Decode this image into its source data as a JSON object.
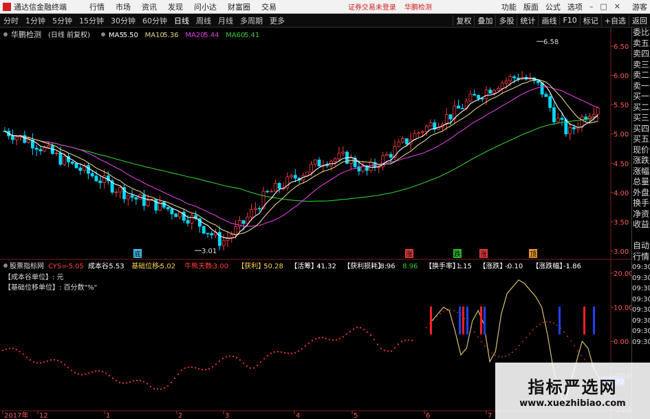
{
  "menubar": {
    "app_title": "通达信金融终端",
    "items": [
      "行情",
      "市场",
      "资讯",
      "发现",
      "问小达",
      "财富圈",
      "交易"
    ],
    "promo_login": "证券交易未登录",
    "promo_broker": "华鹏检测",
    "right_items": [
      "功能",
      "版面",
      "公式",
      "选项"
    ],
    "window_buttons": [
      "–",
      "□",
      "✕"
    ],
    "guest": "游客"
  },
  "periodbar": {
    "tabs": [
      "分时",
      "1分钟",
      "5分钟",
      "15分钟",
      "30分钟",
      "60分钟",
      "日线",
      "周线",
      "月线",
      "多周期",
      "更多"
    ],
    "active_tab": "日线",
    "tools": [
      "复权",
      "叠加",
      "多股",
      "统计",
      "画线",
      "F10",
      "标记",
      "+自选",
      "返回"
    ]
  },
  "main": {
    "stock_name": "华鹏检测",
    "stock_mode": "(日线 前复权)",
    "ma": [
      {
        "label": "MA5",
        "value": "5.50",
        "color": "#ffffff"
      },
      {
        "label": "MA10",
        "value": "5.36",
        "color": "#e8d38a"
      },
      {
        "label": "MA20",
        "value": "5.44",
        "color": "#e040e0"
      },
      {
        "label": "MA60",
        "value": "5.41",
        "color": "#33cc33"
      }
    ],
    "y_ticks": [
      "6.50",
      "6.00",
      "5.50",
      "5.00",
      "4.50",
      "4.00",
      "3.50",
      "3.00"
    ],
    "high_label": "6.58",
    "low_label": "3.01",
    "signals": [
      {
        "text": "底",
        "color": "#4dd2ff"
      },
      {
        "text": "涨",
        "color": "#ff4040"
      },
      {
        "text": "跌",
        "color": "#33cc33"
      },
      {
        "text": "涨",
        "color": "#ff4040"
      },
      {
        "text": "顶",
        "color": "#ffaa33"
      }
    ]
  },
  "sub": {
    "indicator_name": "股票指标网",
    "cys_label": "CYS=",
    "cys_value": "-5.05",
    "items": [
      {
        "label": "成本谷:",
        "value": "5.53",
        "color": "#ffffff"
      },
      {
        "label": "基础位移:",
        "value": "-5.02",
        "color": "#ffd24d"
      },
      {
        "label": "牛熊天数:",
        "value": "-3.00",
        "color": "#ff4040"
      },
      {
        "label": "【获利】:",
        "value": "50.28",
        "color": "#ffd24d"
      },
      {
        "label": "【活筹】:",
        "value": "41.32",
        "color": "#ffffff"
      },
      {
        "label": "【获利损耗】:",
        "value": "8.96",
        "color": "#ffffff"
      },
      {
        "label": "",
        "value": "8.96",
        "color": "#33cc33"
      },
      {
        "label": "【换手率】:",
        "value": "1.15",
        "color": "#ffffff"
      },
      {
        "label": "【涨跌】:",
        "value": "-0.10",
        "color": "#ffffff"
      },
      {
        "label": "【涨跌幅】:",
        "value": "-1.86",
        "color": "#ffffff"
      }
    ],
    "note1": "【成本谷单位】: 元",
    "note2": "【基础位移单位】: 百分数\"%\"",
    "y_ticks": [
      "20.00",
      "10.00",
      "0.00",
      "-10.00",
      "-20.00"
    ],
    "current_value": "-11.70"
  },
  "xaxis": {
    "labels": [
      "2017年",
      "12",
      "1",
      "2",
      "3",
      "4",
      "5",
      "6",
      "7"
    ]
  },
  "ticker_panel": {
    "items": [
      "委比",
      "卖五",
      "卖四",
      "卖三",
      "卖二",
      "卖一",
      "买一",
      "买二",
      "买三",
      "买四",
      "买五",
      "现价",
      "涨跌",
      "涨幅",
      "总量",
      "外盘",
      "换手",
      "净资",
      "收益",
      "",
      "自动",
      "行情",
      "09:30",
      "09:30",
      "09:30",
      "09:30",
      "09:30",
      "09:30",
      "09:30",
      "09:30"
    ]
  },
  "watermark": {
    "cn": "指标严选网",
    "url": "www.xuezhibiao.com"
  },
  "colors": {
    "up": "#ff3c3c",
    "down": "#00d8ff",
    "ma5": "#ffffff",
    "ma10": "#e8d38a",
    "ma20": "#e040e0",
    "ma60": "#33cc33"
  }
}
